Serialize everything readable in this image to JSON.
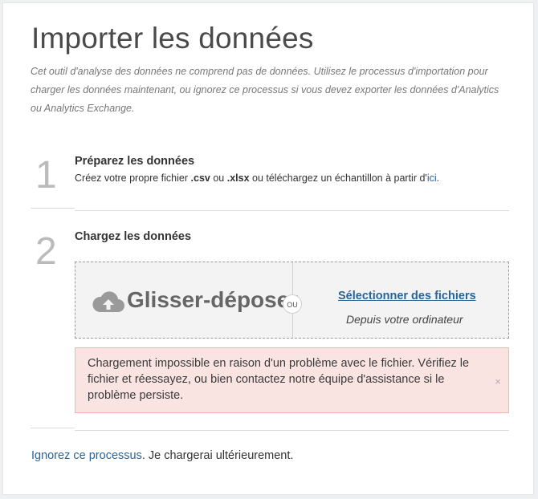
{
  "title": "Importer les données",
  "intro": "Cet outil d'analyse des données ne comprend pas de données. Utilisez le processus d'importation pour charger les données maintenant, ou ignorez ce processus si vous devez exporter les données d'Analytics ou Analytics Exchange.",
  "steps": [
    {
      "number": "1",
      "title": "Préparez les données",
      "desc_before": "Créez votre propre fichier ",
      "ext_csv": ".csv",
      "desc_or": " ou ",
      "ext_xlsx": ".xlsx",
      "desc_after": " ou téléchargez un échantillon à partir d'",
      "link": "ici",
      "desc_end": "."
    },
    {
      "number": "2",
      "title": "Chargez les données"
    }
  ],
  "dropzone": {
    "icon": "cloud-upload-icon",
    "label": "Glisser-déposer",
    "separator": "OU",
    "select_link": "Sélectionner des fichiers",
    "select_sub": "Depuis votre ordinateur"
  },
  "alert": {
    "message": "Chargement impossible en raison d'un problème avec le fichier. Vérifiez le fichier et réessayez, ou bien contactez notre équipe d'assistance si le problème persiste.",
    "close": "×"
  },
  "footer": {
    "link": "Ignorez ce processus",
    "text": ". Je chargerai ultérieurement."
  },
  "colors": {
    "link": "#2a6496",
    "alert_bg": "#f9e4e2",
    "alert_border": "#eab9b5",
    "dropzone_bg": "#f3f3f3"
  }
}
